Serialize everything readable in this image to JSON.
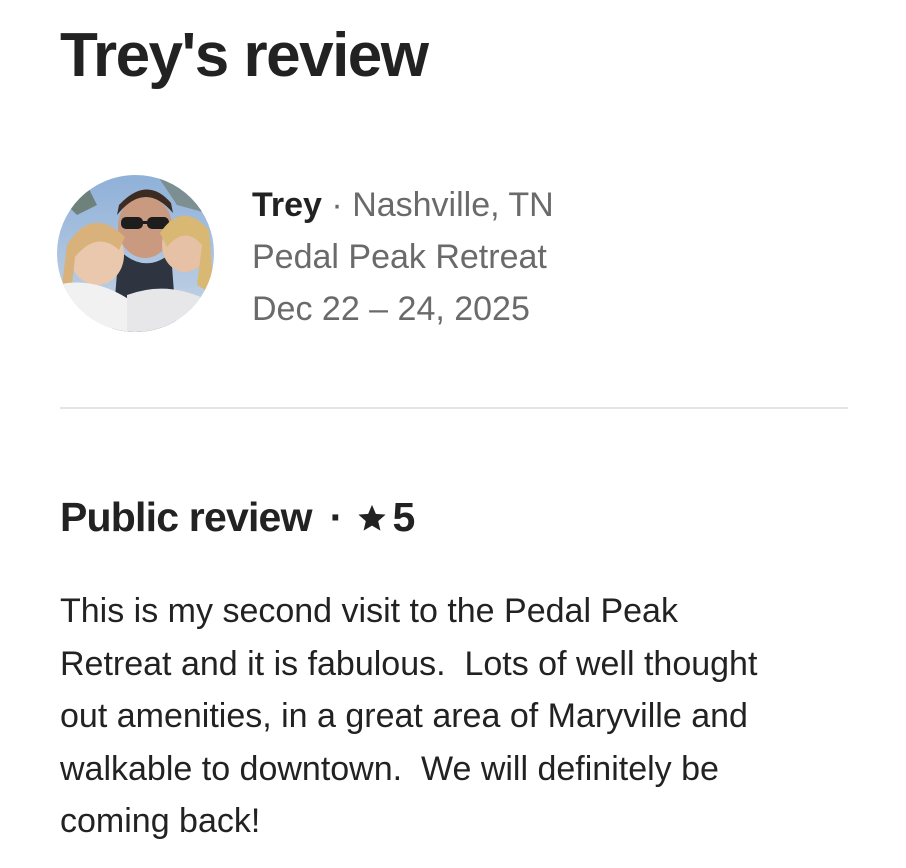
{
  "header": {
    "title": "Trey's review"
  },
  "reviewer": {
    "name": "Trey",
    "separator": "·",
    "location": "Nashville, TN",
    "listing": "Pedal Peak Retreat",
    "dates": "Dec 22 – 24, 2025",
    "avatar_icon": "profile-photo"
  },
  "public_review": {
    "heading": "Public review",
    "separator": "·",
    "rating_icon": "star-icon",
    "rating": "5",
    "text": "This is my second visit to the Pedal Peak\nRetreat and it is fabulous.  Lots of well thought\nout amenities, in a great area of Maryville and\nwalkable to downtown.  We will definitely be\ncoming back!"
  },
  "colors": {
    "primary_text": "#222222",
    "secondary_text": "#6a6a6a",
    "divider": "#e4e4e4"
  }
}
